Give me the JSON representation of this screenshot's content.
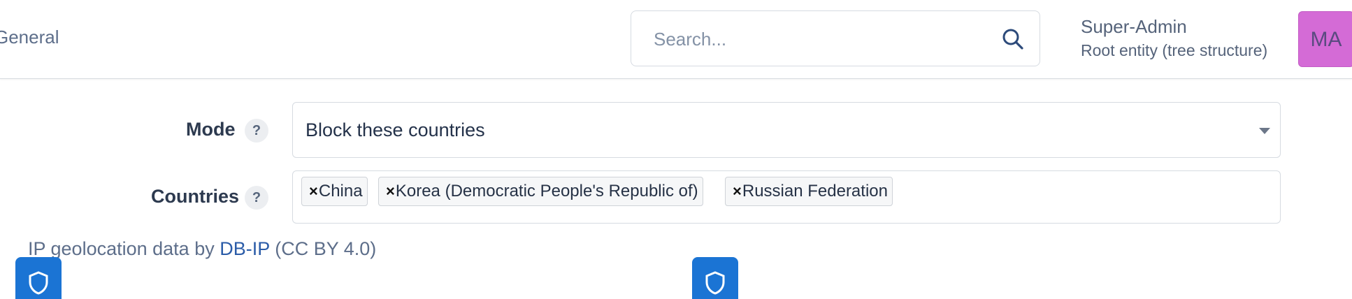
{
  "header": {
    "breadcrumb": "General",
    "search": {
      "placeholder": "Search..."
    },
    "user": {
      "name": "Super-Admin",
      "entity": "Root entity (tree structure)",
      "avatar_initials": "MA",
      "avatar_color": "#d46bd6"
    }
  },
  "form": {
    "mode": {
      "label": "Mode",
      "help": "?",
      "value": "Block these countries"
    },
    "countries": {
      "label": "Countries",
      "help": "?",
      "remove_symbol": "×",
      "tags": [
        "China",
        "Korea (Democratic People's Republic of)",
        "Russian Federation"
      ]
    }
  },
  "attribution": {
    "prefix": "IP geolocation data by ",
    "link": "DB-IP",
    "suffix": " (CC BY 4.0)"
  },
  "accent_color": "#1b74d4",
  "icons": [
    "search-icon",
    "chevron-down-icon",
    "shield-icon"
  ]
}
